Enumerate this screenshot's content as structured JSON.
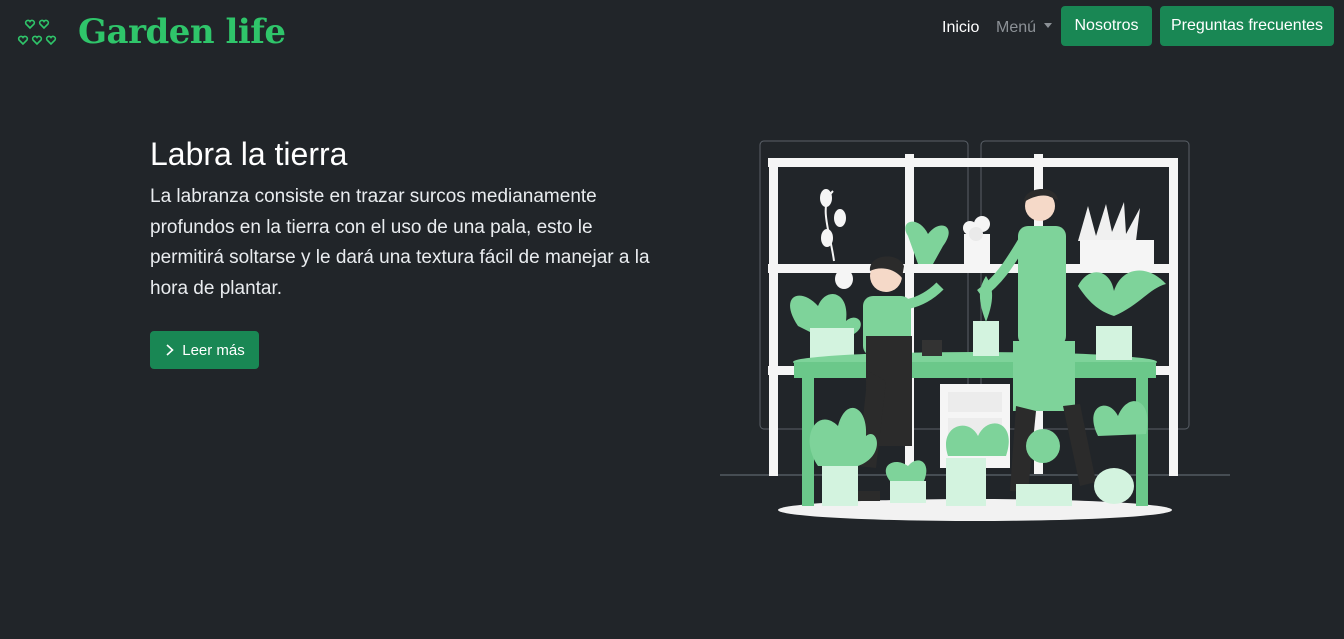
{
  "brand": {
    "name": "Garden life",
    "icon": "hearts-icon",
    "color": "#2fc56a"
  },
  "nav": {
    "inicio": "Inicio",
    "menu": "Menú",
    "nosotros": "Nosotros",
    "faq": "Preguntas frecuentes"
  },
  "hero": {
    "title": "Labra la tierra",
    "text": "La labranza consiste en trazar surcos medianamente profundos en la tierra con el uso de una pala, esto le permitirá soltarse y le dará una textura fácil de manejar a la hora de plantar.",
    "button": "Leer más",
    "button_icon": "chevron-right-icon"
  },
  "colors": {
    "background": "#212529",
    "primary": "#198754",
    "accent_green": "#2fc56a",
    "plant_green": "#7ed39a",
    "text": "#ffffff"
  }
}
